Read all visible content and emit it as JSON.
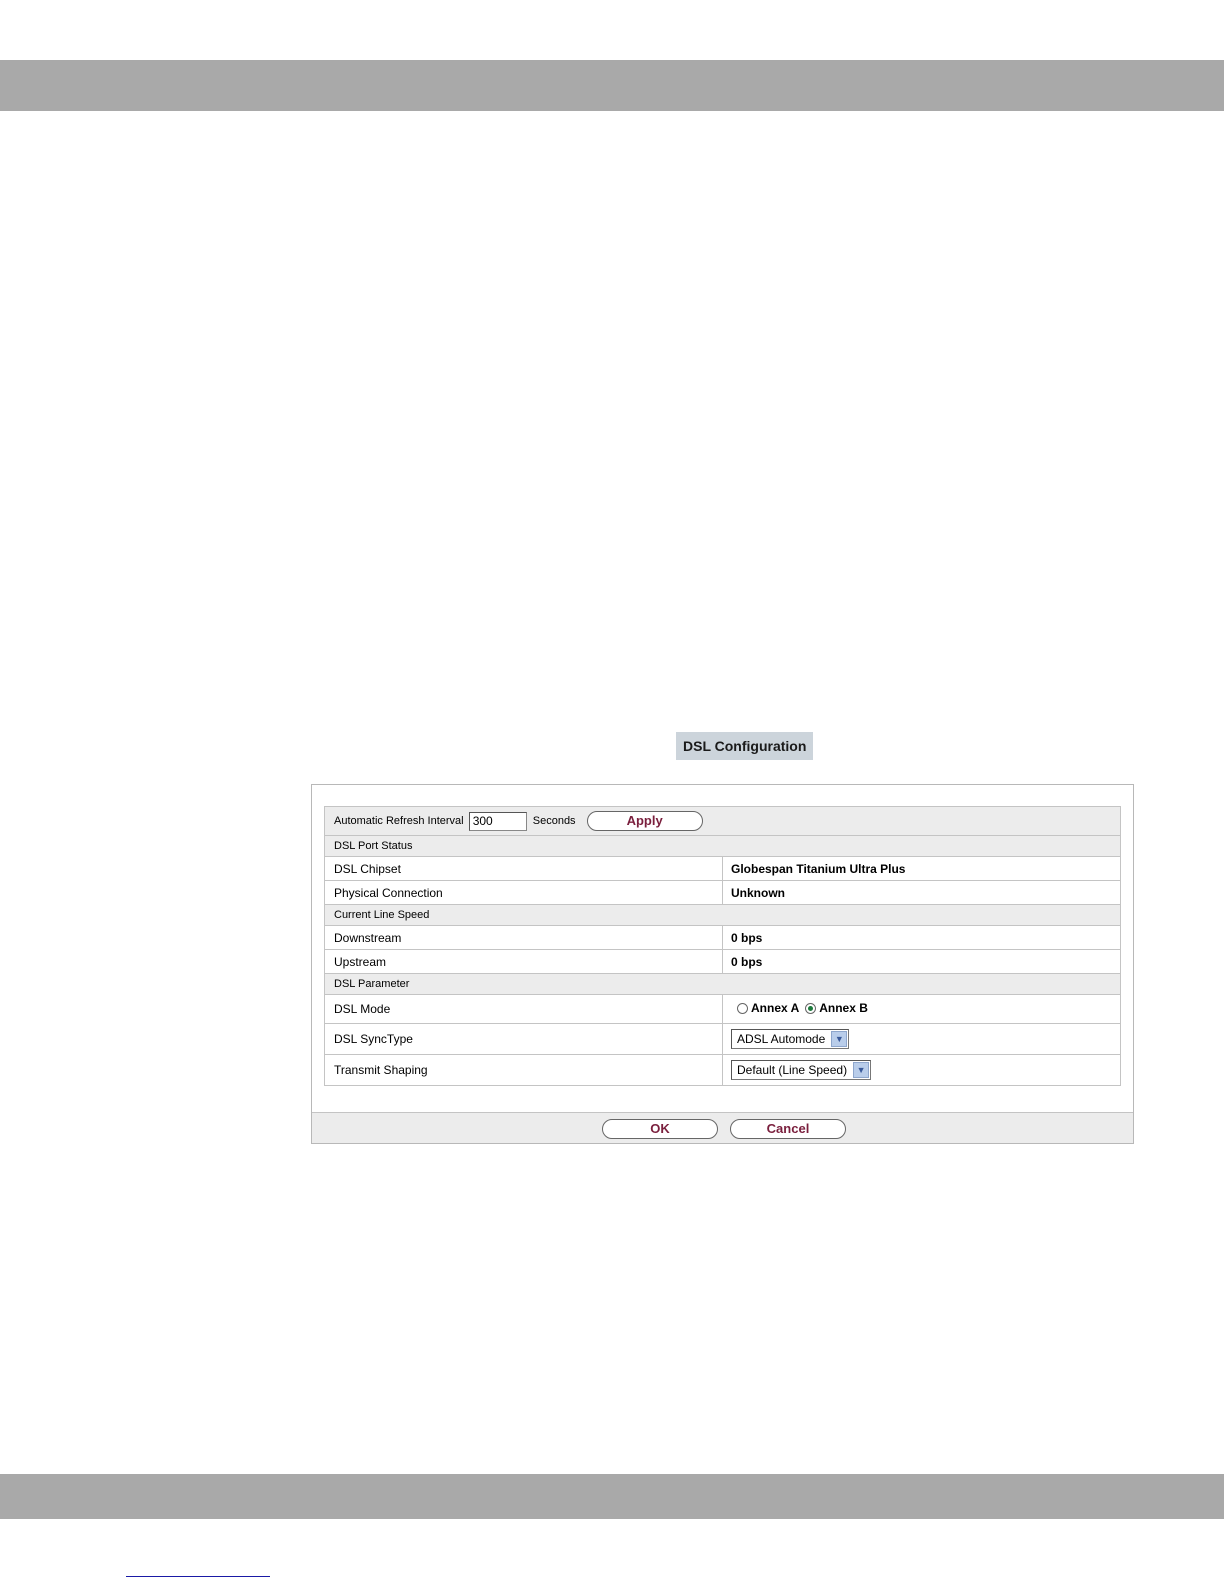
{
  "page": {
    "title": "DSL Configuration"
  },
  "refresh": {
    "label": "Automatic Refresh Interval",
    "value": "300",
    "unit": "Seconds",
    "apply_label": "Apply"
  },
  "sections": {
    "port_status": "DSL Port Status",
    "line_speed": "Current Line Speed",
    "parameter": "DSL Parameter"
  },
  "fields": {
    "chipset": {
      "label": "DSL Chipset",
      "value": "Globespan Titanium Ultra Plus"
    },
    "physical": {
      "label": "Physical Connection",
      "value": "Unknown"
    },
    "downstream": {
      "label": "Downstream",
      "value": "0 bps"
    },
    "upstream": {
      "label": "Upstream",
      "value": "0 bps"
    },
    "mode": {
      "label": "DSL Mode",
      "options": [
        "Annex A",
        "Annex B"
      ],
      "selected": "Annex B"
    },
    "synctype": {
      "label": "DSL SyncType",
      "selected": "ADSL Automode"
    },
    "shaping": {
      "label": "Transmit Shaping",
      "selected": "Default (Line Speed)"
    }
  },
  "footer": {
    "ok_label": "OK",
    "cancel_label": "Cancel"
  },
  "colors": {
    "band": "#a9a9a9",
    "title_bg": "#ccd4db",
    "button_text": "#7a1f3d",
    "radio_checked": "#1d7a3c"
  }
}
